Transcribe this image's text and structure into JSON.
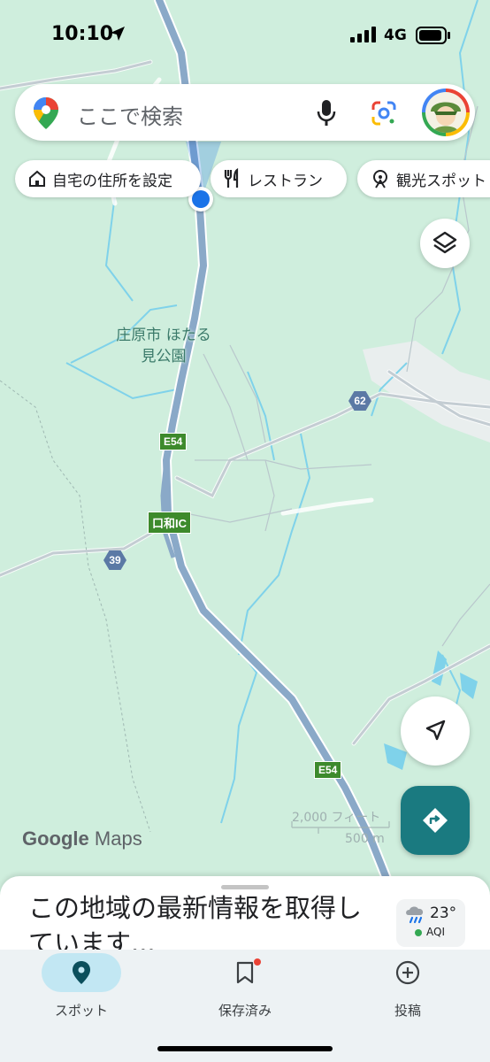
{
  "status_bar": {
    "time": "10:10",
    "network": "4G"
  },
  "search": {
    "placeholder": "ここで検索"
  },
  "chips": [
    {
      "label": "自宅の住所を設定",
      "icon": "home-icon"
    },
    {
      "label": "レストラン",
      "icon": "restaurant-icon"
    },
    {
      "label": "観光スポット",
      "icon": "attraction-icon"
    }
  ],
  "map": {
    "place_label_line1": "庄原市 ほたる",
    "place_label_line2": "見公園",
    "highway_shield_1": "E54",
    "highway_shield_2": "E54",
    "interchange": "口和IC",
    "route_39": "39",
    "route_62": "62",
    "scale_imperial": "2,000 フィート",
    "scale_metric": "500 m",
    "watermark_google": "Google",
    "watermark_maps": "Maps"
  },
  "sheet": {
    "headline": "この地域の最新情報を取得しています...",
    "weather_temp": "23°",
    "weather_aqi": "AQI"
  },
  "nav": {
    "items": [
      {
        "label": "スポット",
        "icon": "place-icon",
        "active": true
      },
      {
        "label": "保存済み",
        "icon": "bookmark-icon",
        "active": false
      },
      {
        "label": "投稿",
        "icon": "add-circle-icon",
        "active": false
      }
    ]
  },
  "colors": {
    "map_land": "#cfeedd",
    "highway": "#8aa9c8",
    "water": "#7fd2ea",
    "accent_teal": "#1a7a80",
    "active_pill": "#c2e7f3",
    "location_blue": "#1a73e8"
  }
}
